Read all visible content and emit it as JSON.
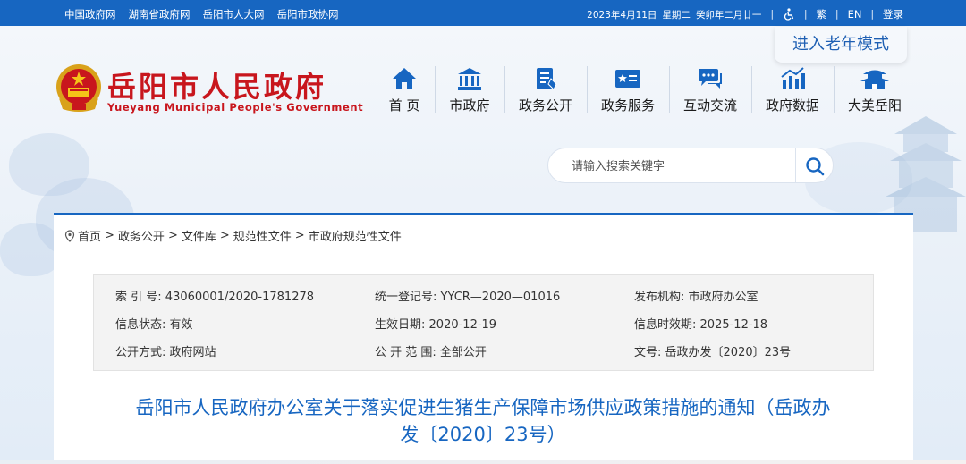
{
  "topbar": {
    "links": [
      "中国政府网",
      "湖南省政府网",
      "岳阳市人大网",
      "岳阳市政协网"
    ],
    "date": "2023年4月11日",
    "weekday": "星期二",
    "lunar": "癸卯年二月廿一",
    "traditional": "繁",
    "english": "EN",
    "login": "登录",
    "accessibility_icon": "wheelchair-icon"
  },
  "elder_mode": "进入老年模式",
  "logo": {
    "title": "岳阳市人民政府",
    "subtitle": "Yueyang Municipal People's Government",
    "emblem_icon": "national-emblem-icon"
  },
  "nav": [
    {
      "label": "首 页",
      "icon": "home-icon"
    },
    {
      "label": "市政府",
      "icon": "government-building-icon"
    },
    {
      "label": "政务公开",
      "icon": "document-icon"
    },
    {
      "label": "政务服务",
      "icon": "service-card-icon"
    },
    {
      "label": "互动交流",
      "icon": "chat-icon"
    },
    {
      "label": "政府数据",
      "icon": "bar-chart-icon"
    },
    {
      "label": "大美岳阳",
      "icon": "pavilion-icon"
    }
  ],
  "search": {
    "placeholder": "请输入搜索关键字",
    "icon": "search-icon"
  },
  "breadcrumb": [
    "首页",
    "政务公开",
    "文件库",
    "规范性文件",
    "市政府规范性文件"
  ],
  "meta": {
    "index_label": "索 引 号:",
    "index_value": "43060001/2020-1781278",
    "reg_label": "统一登记号:",
    "reg_value": "YYCR—2020—01016",
    "org_label": "发布机构:",
    "org_value": "市政府办公室",
    "status_label": "信息状态:",
    "status_value": "有效",
    "effective_label": "生效日期:",
    "effective_value": "2020-12-19",
    "expire_label": "信息时效期:",
    "expire_value": "2025-12-18",
    "method_label": "公开方式:",
    "method_value": "政府网站",
    "scope_label": "公 开 范 围:",
    "scope_value": "全部公开",
    "docno_label": "文号:",
    "docno_value": "岳政办发〔2020〕23号"
  },
  "doc_title_line1": "岳阳市人民政府办公室关于落实促进生猪生产保障市场供应政策措施的通知（岳政办",
  "doc_title_line2": "发〔2020〕23号）",
  "colors": {
    "brand_blue": "#1766c1",
    "title_red": "#c8161d"
  }
}
